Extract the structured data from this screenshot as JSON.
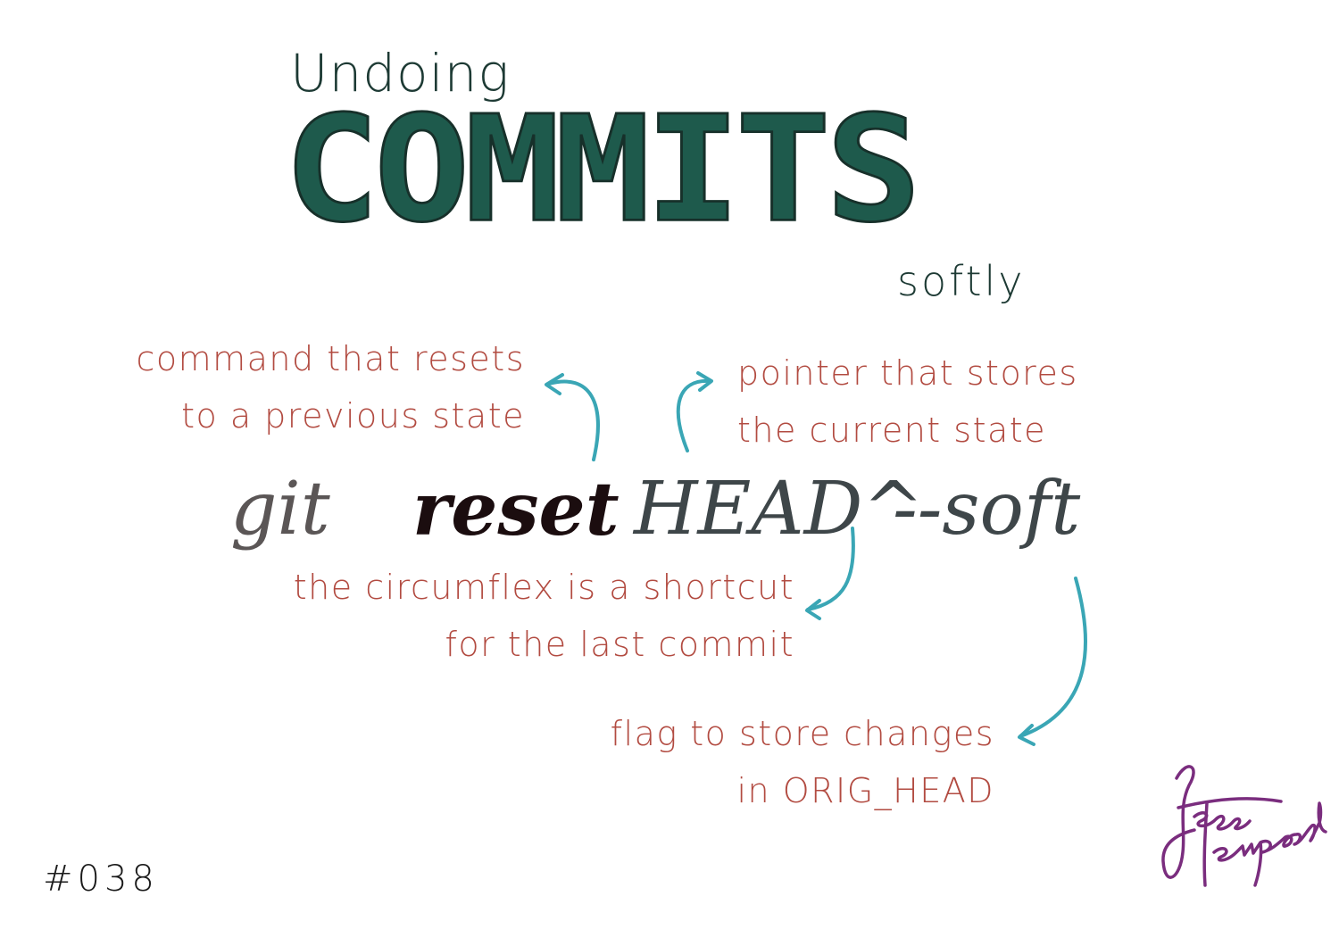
{
  "title": {
    "prefix": "Undoing",
    "main": "COMMITS",
    "suffix": "softly"
  },
  "command": {
    "git": "git",
    "reset": "reset",
    "head": "HEAD^",
    "soft": "--soft"
  },
  "annotations": {
    "reset": {
      "line1": "command that resets",
      "line2": "to a previous state"
    },
    "head": {
      "line1": "pointer that stores",
      "line2": "the current state"
    },
    "circumflex": {
      "line1": "the circumflex is a shortcut",
      "line2": "for the last commit"
    },
    "soft": {
      "line1": "flag to store changes",
      "line2": "in ORIG_HEAD"
    }
  },
  "issue_number": "#038",
  "signature": "Jess Temporal",
  "colors": {
    "title": "#1e5a4c",
    "annotation": "#b24b41",
    "arrow": "#3aa6b5",
    "signature": "#7a2d7e"
  }
}
